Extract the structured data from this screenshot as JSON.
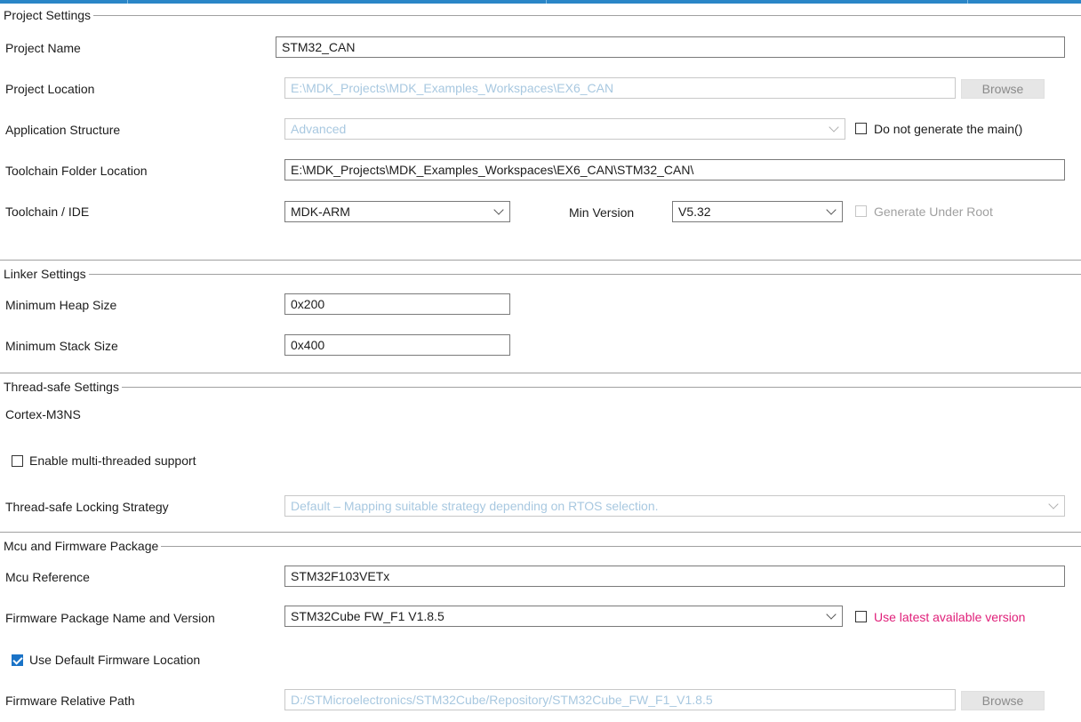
{
  "project_settings": {
    "title": "Project Settings",
    "project_name": {
      "label": "Project Name",
      "value": "STM32_CAN"
    },
    "project_location": {
      "label": "Project Location",
      "value": "E:\\MDK_Projects\\MDK_Examples_Workspaces\\EX6_CAN",
      "browse": "Browse"
    },
    "application_structure": {
      "label": "Application Structure",
      "value": "Advanced",
      "checkbox_label": "Do not generate the main()",
      "checked": false
    },
    "toolchain_folder": {
      "label": "Toolchain Folder Location",
      "value": "E:\\MDK_Projects\\MDK_Examples_Workspaces\\EX6_CAN\\STM32_CAN\\"
    },
    "toolchain_ide": {
      "label": "Toolchain / IDE",
      "value": "MDK-ARM",
      "min_version_label": "Min Version",
      "min_version": "V5.32",
      "generate_under_root": "Generate Under Root",
      "generate_under_root_checked": false
    }
  },
  "linker_settings": {
    "title": "Linker Settings",
    "heap": {
      "label": "Minimum Heap Size",
      "value": "0x200"
    },
    "stack": {
      "label": "Minimum Stack Size",
      "value": "0x400"
    }
  },
  "thread_safe": {
    "title": "Thread-safe Settings",
    "core": "Cortex-M3NS",
    "multithread": {
      "label": "Enable multi-threaded support",
      "checked": false
    },
    "locking": {
      "label": "Thread-safe Locking Strategy",
      "value": "Default  –  Mapping suitable strategy depending on RTOS selection."
    }
  },
  "mcu_firmware": {
    "title": "Mcu and Firmware Package",
    "mcu_reference": {
      "label": "Mcu Reference",
      "value": "STM32F103VETx"
    },
    "firmware_package": {
      "label": "Firmware Package Name and Version",
      "value": "STM32Cube FW_F1 V1.8.5",
      "latest_label": "Use latest available version",
      "latest_checked": false
    },
    "default_location": {
      "label": "Use Default Firmware Location",
      "checked": true
    },
    "relative_path": {
      "label": "Firmware Relative Path",
      "value": "D:/STMicroelectronics/STM32Cube/Repository/STM32Cube_FW_F1_V1.8.5",
      "browse": "Browse"
    }
  },
  "colors": {
    "accent": "#2a86c7",
    "checked": "#1a73c7",
    "pink_label": "#e0207a",
    "disabled_text": "#a8c8e0"
  }
}
